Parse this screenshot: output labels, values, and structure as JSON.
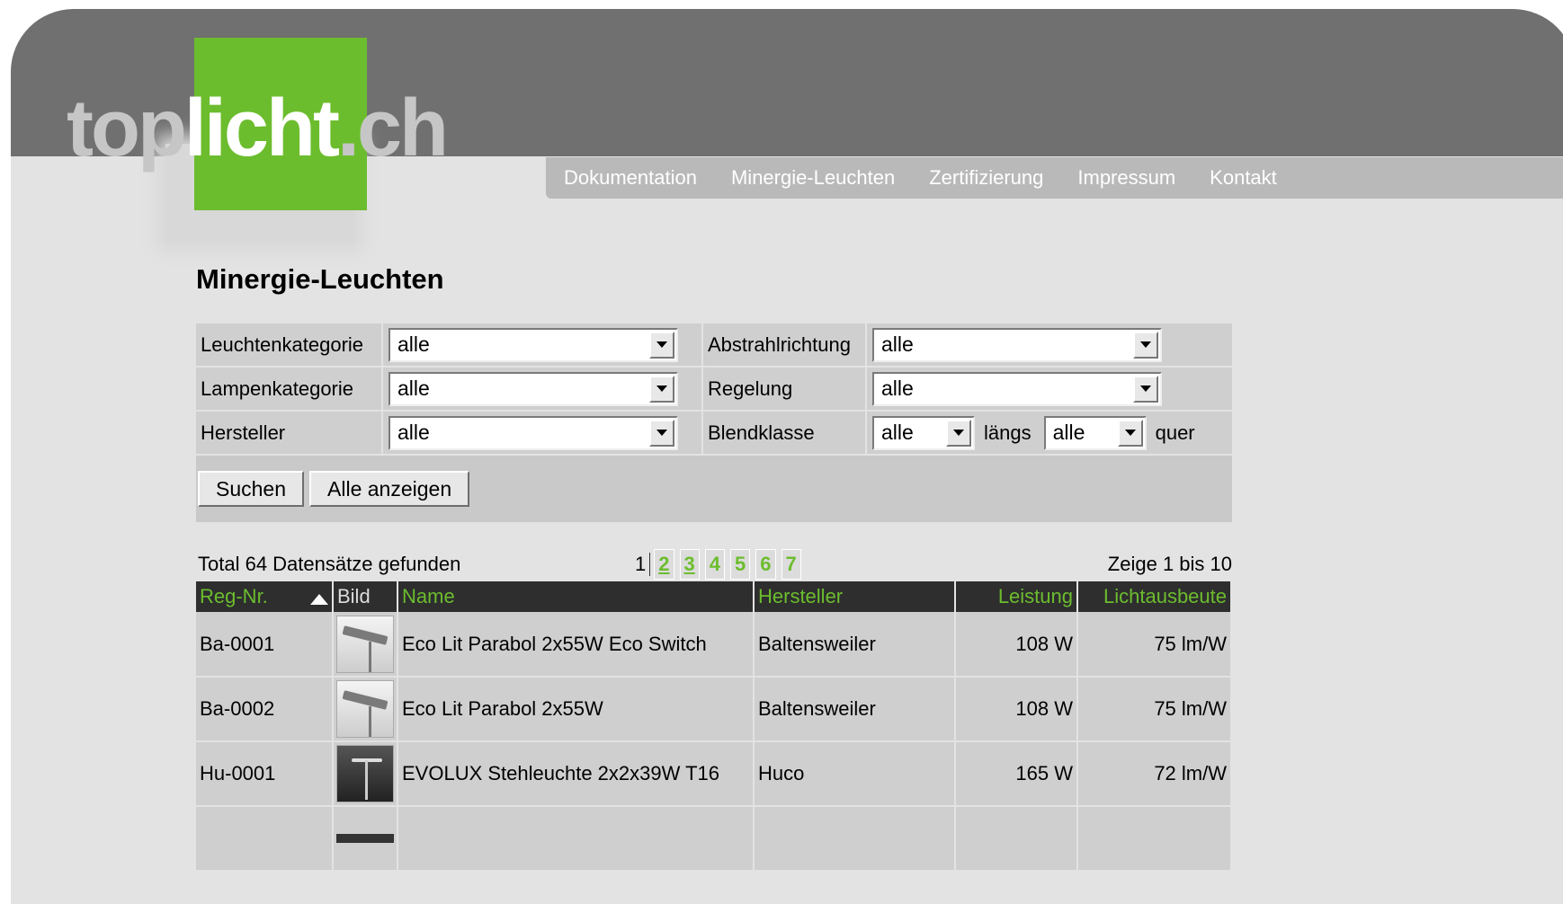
{
  "logo": {
    "part1": "top",
    "part2": "licht",
    "part3": ".ch",
    "accent": "#6cbd2e"
  },
  "nav": [
    "Dokumentation",
    "Minergie-Leuchten",
    "Zertifizierung",
    "Impressum",
    "Kontakt"
  ],
  "page_title": "Minergie-Leuchten",
  "filters": {
    "leuchtenkategorie": {
      "label": "Leuchtenkategorie",
      "value": "alle"
    },
    "abstrahlrichtung": {
      "label": "Abstrahlrichtung",
      "value": "alle"
    },
    "lampenkategorie": {
      "label": "Lampenkategorie",
      "value": "alle"
    },
    "regelung": {
      "label": "Regelung",
      "value": "alle"
    },
    "hersteller": {
      "label": "Hersteller",
      "value": "alle"
    },
    "blendklasse": {
      "label": "Blendklasse",
      "value_laengs": "alle",
      "laengs_label": "längs",
      "value_quer": "alle",
      "quer_label": "quer"
    }
  },
  "buttons": {
    "search": "Suchen",
    "show_all": "Alle anzeigen"
  },
  "summary": {
    "total": "Total 64 Datensätze gefunden",
    "showing": "Zeige 1 bis 10",
    "current_page": "1",
    "pages": [
      "2",
      "3",
      "4",
      "5",
      "6",
      "7"
    ]
  },
  "table": {
    "headers": {
      "reg_nr": "Reg-Nr.",
      "bild": "Bild",
      "name": "Name",
      "hersteller": "Hersteller",
      "leistung": "Leistung",
      "lichtausbeute": "Lichtausbeute"
    },
    "rows": [
      {
        "reg_nr": "Ba-0001",
        "name": "Eco Lit Parabol 2x55W Eco Switch",
        "hersteller": "Baltensweiler",
        "leistung": "108 W",
        "lichtausbeute": "75 lm/W"
      },
      {
        "reg_nr": "Ba-0002",
        "name": "Eco Lit Parabol 2x55W",
        "hersteller": "Baltensweiler",
        "leistung": "108 W",
        "lichtausbeute": "75 lm/W"
      },
      {
        "reg_nr": "Hu-0001",
        "name": "EVOLUX Stehleuchte 2x2x39W T16",
        "hersteller": "Huco",
        "leistung": "165 W",
        "lichtausbeute": "72 lm/W"
      }
    ]
  }
}
